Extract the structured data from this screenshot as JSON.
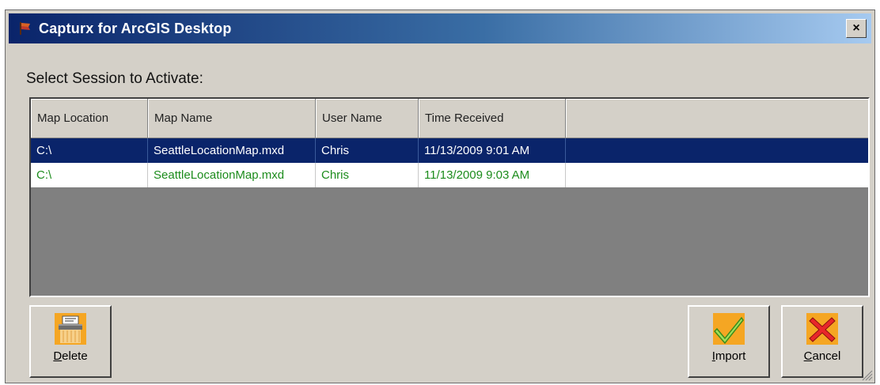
{
  "window": {
    "title": "Capturx for ArcGIS Desktop",
    "close_label": "×"
  },
  "prompt": "Select Session to Activate:",
  "table": {
    "columns": [
      "Map Location",
      "Map Name",
      "User Name",
      "Time Received"
    ],
    "rows": [
      {
        "location": "C:\\",
        "map_name": "SeattleLocationMap.mxd",
        "user": "Chris",
        "time": "11/13/2009 9:01 AM",
        "selected": true
      },
      {
        "location": "C:\\",
        "map_name": "SeattleLocationMap.mxd",
        "user": "Chris",
        "time": "11/13/2009 9:03 AM",
        "selected": false
      }
    ]
  },
  "buttons": {
    "delete": {
      "label_first": "D",
      "label_rest": "elete",
      "icon": "shredder-icon"
    },
    "import": {
      "label_first": "I",
      "label_rest": "mport",
      "icon": "checkmark-icon"
    },
    "cancel": {
      "label_first": "C",
      "label_rest": "ancel",
      "icon": "red-x-icon"
    }
  },
  "colors": {
    "selected_row_bg": "#0a246a",
    "unselected_row_text": "#1c8c1c",
    "button_icon_bg": "#f5a623"
  }
}
